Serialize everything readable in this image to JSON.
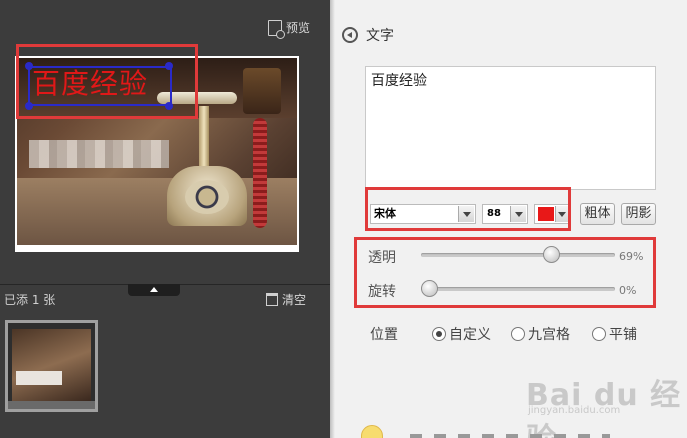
{
  "left_panel": {
    "preview_label": "预览",
    "watermark_text": "百度经验",
    "added_count_label": "已添 1 张",
    "clear_label": "清空"
  },
  "right_panel": {
    "back_title": "文字",
    "text_input_value": "百度经验",
    "font_family": "宋体",
    "font_size": "88",
    "color_hex": "#e81818",
    "bold_label": "粗体",
    "shadow_label": "阴影",
    "opacity_label": "透明",
    "opacity_value": "69%",
    "rotate_label": "旋转",
    "rotate_value": "0%",
    "position_label": "位置",
    "position_options": [
      "自定义",
      "九宫格",
      "平铺"
    ],
    "position_selected": "自定义"
  },
  "watermark_site": {
    "logo_text": "Bai du 经验",
    "sub_text": "jingyan.baidu.com"
  },
  "colors": {
    "highlight": "#e03a3a",
    "watermark_box": "#2a2ac8"
  }
}
